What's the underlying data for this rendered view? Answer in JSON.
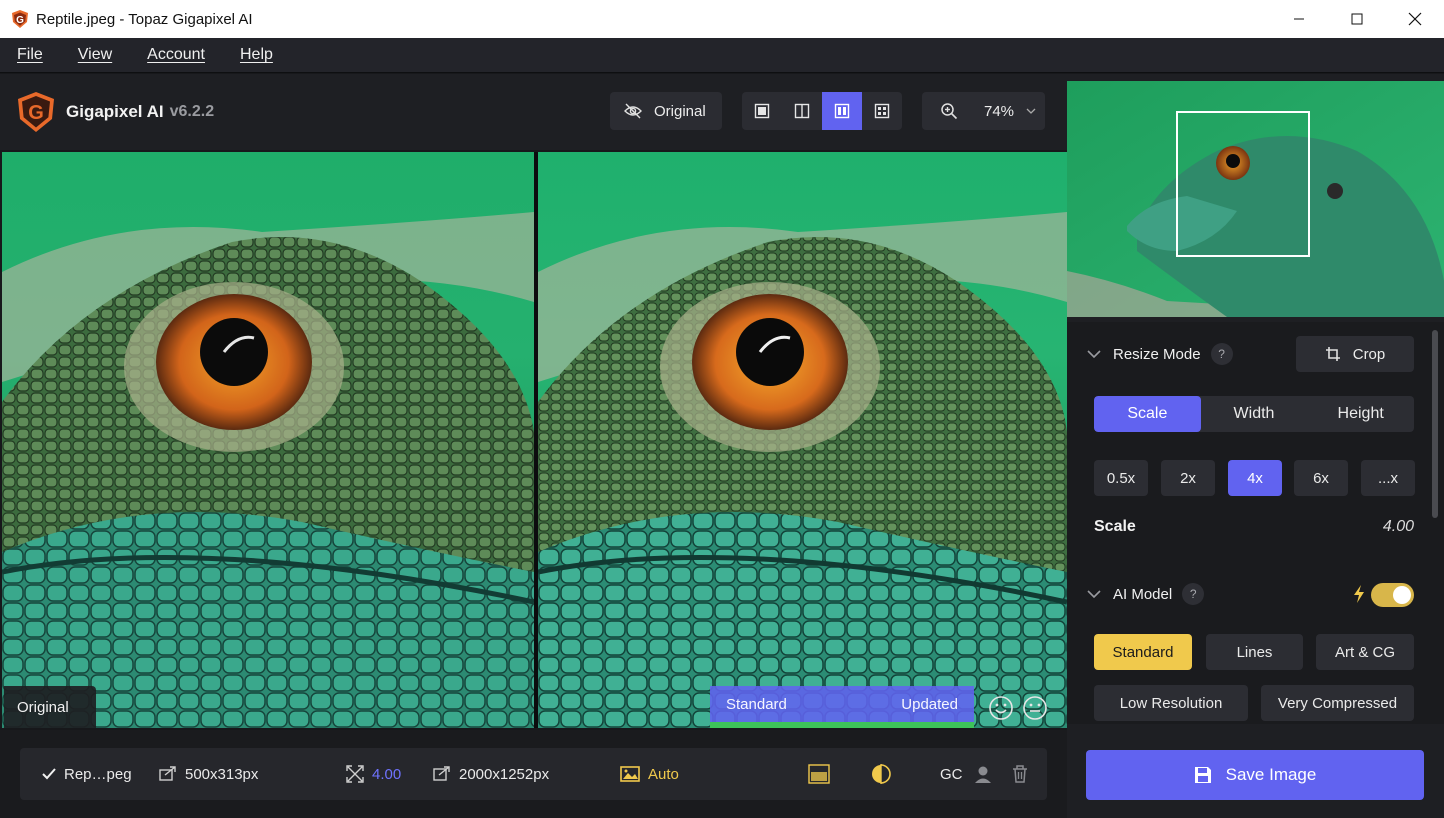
{
  "window": {
    "title": "Reptile.jpeg - Topaz Gigapixel AI"
  },
  "menu": [
    "File",
    "View",
    "Account",
    "Help"
  ],
  "header": {
    "app_name": "Gigapixel AI",
    "version": "v6.2.2",
    "original_toggle": "Original",
    "view_modes": [
      "single-view-icon",
      "split-view-icon",
      "side-by-side-view-icon",
      "quad-view-icon"
    ],
    "active_view_mode": 2,
    "zoom_level": "74%"
  },
  "preview_panes": {
    "left_label": "Original",
    "right_status_left": "Standard",
    "right_status_right": "Updated",
    "progress_fraction": 1.0
  },
  "file_bar": {
    "file_name": "Rep…peg",
    "input_size": "500x313px",
    "scale_value": "4.00",
    "output_size": "2000x1252px",
    "auto_label": "Auto",
    "gc_label": "GC"
  },
  "settings": {
    "resize_mode_label": "Resize Mode",
    "help": "?",
    "crop_label": "Crop",
    "resize_tabs": [
      "Scale",
      "Width",
      "Height"
    ],
    "active_resize_tab": 0,
    "scale_presets": [
      "0.5x",
      "2x",
      "4x",
      "6x",
      "...x"
    ],
    "active_scale_preset": 2,
    "scale_label": "Scale",
    "scale_value": "4.00",
    "ai_model_label": "AI Model",
    "ai_toggle_on": true,
    "models_row1": [
      "Standard",
      "Lines",
      "Art & CG"
    ],
    "models_row2": [
      "Low Resolution",
      "Very Compressed"
    ],
    "active_model": 0
  },
  "save": {
    "label": "Save Image"
  },
  "colors": {
    "accent_blue": "#6163f0",
    "accent_gold": "#f0c94c",
    "progress_green": "#3dc35a",
    "logo_orange": "#e8692a"
  }
}
